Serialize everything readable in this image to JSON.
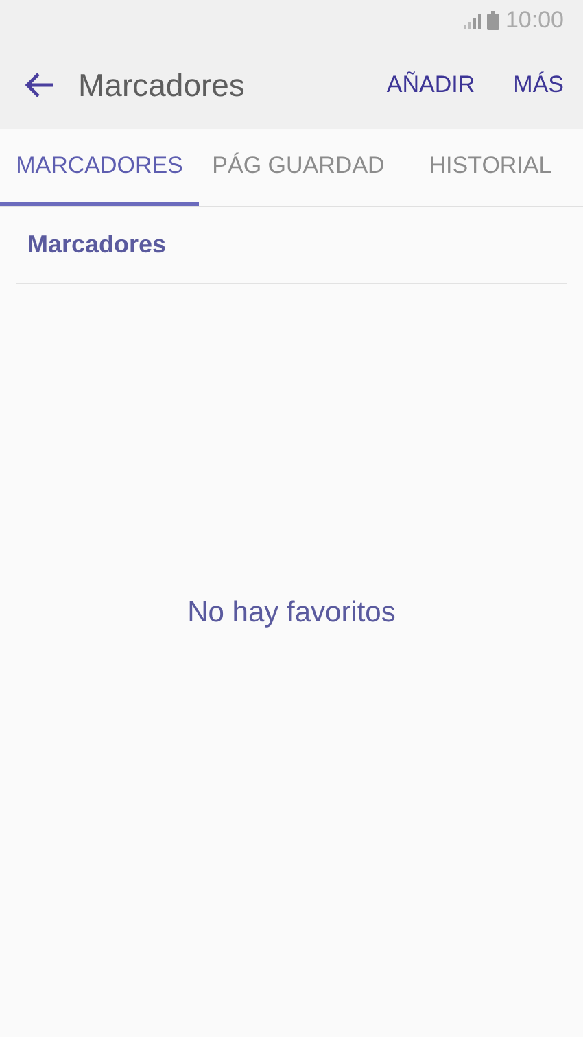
{
  "status_bar": {
    "time": "10:00"
  },
  "app_bar": {
    "title": "Marcadores",
    "actions": [
      "AÑADIR",
      "MÁS"
    ]
  },
  "tabs": [
    {
      "label": "MARCADORES",
      "selected": true
    },
    {
      "label": "PÁG GUARDAD",
      "selected": false
    },
    {
      "label": "HISTORIAL",
      "selected": false
    }
  ],
  "section": {
    "title": "Marcadores"
  },
  "empty_message": "No hay favoritos"
}
